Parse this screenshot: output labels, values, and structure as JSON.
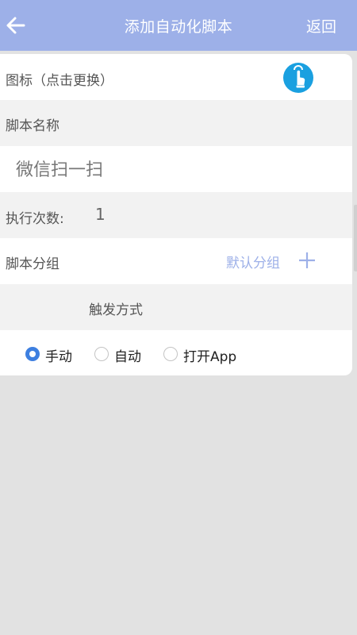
{
  "header": {
    "title": "添加自动化脚本",
    "back_label": "返回",
    "color": "#9db0e8"
  },
  "form": {
    "icon_label": "图标（点击更换）",
    "icon": "touch-icon",
    "icon_color": "#1aa0e0",
    "name_label": "脚本名称",
    "name_value": "微信扫一扫",
    "count_label": "执行次数:",
    "count_value": "1",
    "group_label": "脚本分组",
    "group_value": "默认分组",
    "trigger_label": "触发方式",
    "trigger_options": [
      {
        "label": "手动",
        "selected": true
      },
      {
        "label": "自动",
        "selected": false
      },
      {
        "label": "打开App",
        "selected": false
      }
    ]
  }
}
